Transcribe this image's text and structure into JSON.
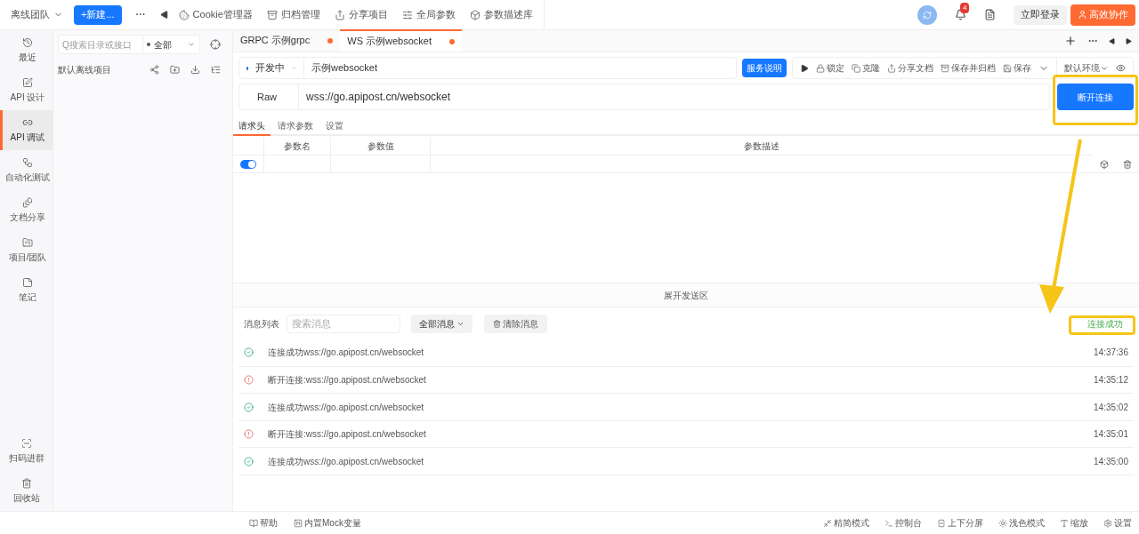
{
  "topbar": {
    "team": "离线团队",
    "new_button": "+新建...",
    "more": "···",
    "tools": [
      "Cookie管理器",
      "归档管理",
      "分享项目",
      "全局参数",
      "参数描述库"
    ],
    "notification_count": "4",
    "login": "立即登录",
    "collab": "高效协作"
  },
  "sidebar": {
    "items": [
      {
        "label": "最近",
        "selected": false
      },
      {
        "label": "API 设计",
        "selected": false
      },
      {
        "label": "API 调试",
        "selected": true
      },
      {
        "label": "自动化测试",
        "selected": false
      },
      {
        "label": "文档分享",
        "selected": false
      },
      {
        "label": "项目/团队",
        "selected": false
      },
      {
        "label": "笔记",
        "selected": false
      }
    ],
    "bottom_items": [
      "扫码进群",
      "回收站"
    ]
  },
  "tree": {
    "search": {
      "placeholder": "Q搜索目录或接口"
    },
    "filter": "全部",
    "project": "默认离线项目"
  },
  "tabs": [
    {
      "label": "GRPC 示例grpc",
      "selected": false,
      "unsaved": true
    },
    {
      "label": "WS 示例websocket",
      "selected": true,
      "unsaved": true
    }
  ],
  "request": {
    "status": "开发中",
    "name": "示例websocket",
    "service_button": "服务说明",
    "actions": [
      "锁定",
      "克隆",
      "分享文档",
      "保存并归档",
      "保存"
    ],
    "environment": "默认环境",
    "format": "Raw",
    "url": "wss://go.apipost.cn/websocket",
    "connect_button": "断开连接"
  },
  "subtabs": [
    {
      "label": "请求头",
      "selected": true
    },
    {
      "label": "请求参数",
      "selected": false
    },
    {
      "label": "设置",
      "selected": false
    }
  ],
  "table": {
    "columns": [
      "参数名",
      "参数值",
      "参数描述"
    ],
    "rows": [
      {
        "enabled": true
      }
    ]
  },
  "send_area": "展开发送区",
  "messages": {
    "label": "消息列表",
    "search": {
      "placeholder": "搜索消息"
    },
    "filter": "全部消息",
    "clear": "清除消息",
    "status": "连接成功",
    "rows": [
      {
        "kind": "success",
        "text": "连接成功wss://go.apipost.cn/websocket",
        "time": "14:37:36"
      },
      {
        "kind": "disconnect",
        "text": "断开连接:wss://go.apipost.cn/websocket",
        "time": "14:35:12"
      },
      {
        "kind": "success",
        "text": "连接成功wss://go.apipost.cn/websocket",
        "time": "14:35:02"
      },
      {
        "kind": "disconnect",
        "text": "断开连接:wss://go.apipost.cn/websocket",
        "time": "14:35:01"
      },
      {
        "kind": "success",
        "text": "连接成功wss://go.apipost.cn/websocket",
        "time": "14:35:00"
      }
    ]
  },
  "status_bar": {
    "left": [
      "帮助",
      "内置Mock变量"
    ],
    "right": [
      "精简模式",
      "控制台",
      "上下分屏",
      "浅色模式",
      "缩放",
      "设置"
    ]
  }
}
